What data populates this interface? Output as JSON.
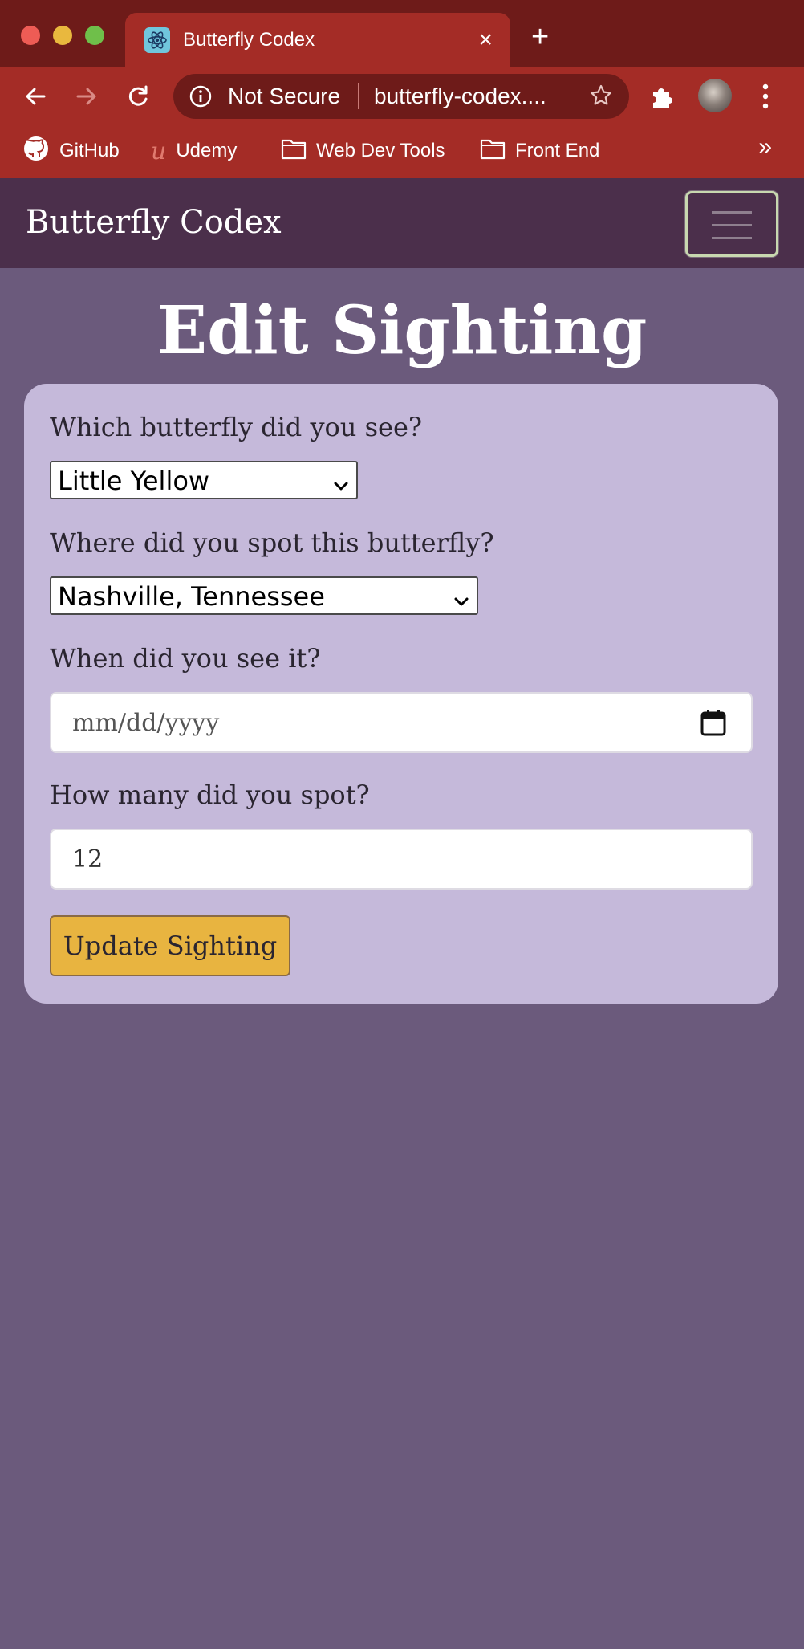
{
  "browser": {
    "tab_title": "Butterfly Codex",
    "tab_close": "×",
    "new_tab": "+",
    "security_label": "Not Secure",
    "url": "butterfly-codex....",
    "bookmarks": [
      "GitHub",
      "Udemy",
      "Web Dev Tools",
      "Front End"
    ],
    "bookmarks_overflow": "»"
  },
  "navbar": {
    "brand": "Butterfly Codex"
  },
  "page": {
    "title": "Edit Sighting"
  },
  "form": {
    "butterfly_label": "Which butterfly did you see?",
    "butterfly_value": "Little Yellow",
    "location_label": "Where did you spot this butterfly?",
    "location_value": "Nashville, Tennessee",
    "date_label": "When did you see it?",
    "date_placeholder": "mm/dd/yyyy",
    "count_label": "How many did you spot?",
    "count_value": "12",
    "submit_label": "Update Sighting"
  },
  "colors": {
    "browser_frame": "#a42c26",
    "navbar": "#4b2f4b",
    "page_bg": "#6b5a7c",
    "card_bg": "#c5b9da",
    "button": "#e8b440"
  }
}
